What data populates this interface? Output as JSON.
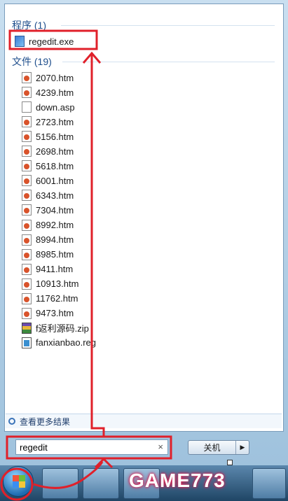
{
  "groups": {
    "programs_header": "程序 (1)",
    "files_header": "文件 (19)"
  },
  "program": {
    "name": "regedit.exe",
    "icon": "regedit-icon"
  },
  "files": [
    {
      "name": "2070.htm",
      "icon": "htm"
    },
    {
      "name": "4239.htm",
      "icon": "htm"
    },
    {
      "name": "down.asp",
      "icon": "asp"
    },
    {
      "name": "2723.htm",
      "icon": "htm"
    },
    {
      "name": "5156.htm",
      "icon": "htm"
    },
    {
      "name": "2698.htm",
      "icon": "htm"
    },
    {
      "name": "5618.htm",
      "icon": "htm"
    },
    {
      "name": "6001.htm",
      "icon": "htm"
    },
    {
      "name": "6343.htm",
      "icon": "htm"
    },
    {
      "name": "7304.htm",
      "icon": "htm"
    },
    {
      "name": "8992.htm",
      "icon": "htm"
    },
    {
      "name": "8994.htm",
      "icon": "htm"
    },
    {
      "name": "8985.htm",
      "icon": "htm"
    },
    {
      "name": "9411.htm",
      "icon": "htm"
    },
    {
      "name": "10913.htm",
      "icon": "htm"
    },
    {
      "name": "11762.htm",
      "icon": "htm"
    },
    {
      "name": "9473.htm",
      "icon": "htm"
    },
    {
      "name": "f返利源码.zip",
      "icon": "zip"
    },
    {
      "name": "fanxianbao.reg",
      "icon": "reg"
    }
  ],
  "more_results": "查看更多结果",
  "search": {
    "value": "regedit",
    "clear": "×"
  },
  "shutdown": {
    "label": "关机",
    "arrow": "▶"
  },
  "watermark": "GAME773",
  "colors": {
    "annotation": "#e0202a",
    "group_header": "#1e4e8c"
  }
}
